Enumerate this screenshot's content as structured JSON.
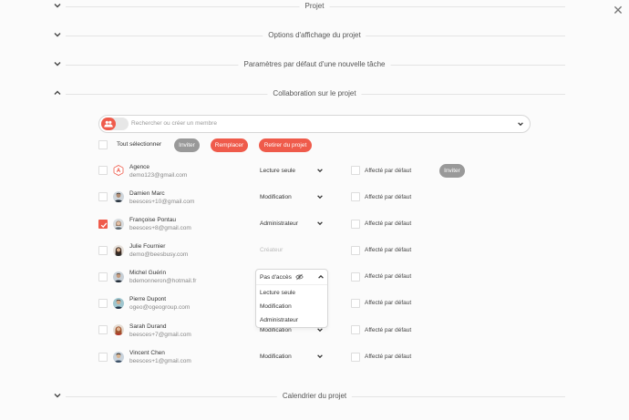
{
  "sections": {
    "projet": "Projet",
    "affichage": "Options d'affichage du projet",
    "parametres": "Paramètres par défaut d'une nouvelle tâche",
    "collaboration": "Collaboration sur le projet",
    "calendrier": "Calendrier du projet"
  },
  "search": {
    "placeholder": "Rechercher ou créer un membre"
  },
  "bulk": {
    "select_all": "Tout sélectionner",
    "invite": "Inviter",
    "replace": "Remplacer",
    "remove": "Retirer du projet"
  },
  "members": [
    {
      "name": "Agence",
      "email": "demo123@gmail.com",
      "role": "Lecture seule",
      "affect": "Affecté par défaut",
      "checked": false,
      "invite": "Inviter"
    },
    {
      "name": "Damien Marc",
      "email": "beesces+10@gmail.com",
      "role": "Modification",
      "affect": "Affecté par défaut",
      "checked": false
    },
    {
      "name": "Françoise Pontau",
      "email": "beesces+8@gmail.com",
      "role": "Administrateur",
      "affect": "Affecté par défaut",
      "checked": true
    },
    {
      "name": "Julie Fournier",
      "email": "demo@beesbusy.com",
      "role": "Créateur",
      "affect": "Affecté par défaut",
      "checked": false
    },
    {
      "name": "Michel Guérin",
      "email": "bdemonneron@hotmail.fr",
      "role": "Pas d'accès",
      "affect": "Affecté par défaut",
      "checked": false
    },
    {
      "name": "Pierre Dupont",
      "email": "ogeo@ogeogroup.com",
      "role": "",
      "affect": "Affecté par défaut",
      "checked": false
    },
    {
      "name": "Sarah Durand",
      "email": "beesces+7@gmail.com",
      "role": "Modification",
      "affect": "Affecté par défaut",
      "checked": false
    },
    {
      "name": "Vincent Chen",
      "email": "beesces+1@gmail.com",
      "role": "Modification",
      "affect": "Affecté par défaut",
      "checked": false
    }
  ],
  "role_dropdown": {
    "selected": "Pas d'accès",
    "options": [
      "Lecture seule",
      "Modification",
      "Administrateur"
    ]
  },
  "colors": {
    "accent": "#ef5b4b",
    "grey_button": "#999999"
  },
  "icons": {
    "close": "close-icon",
    "chevron": "chevron-down-icon",
    "team": "team-icon",
    "hidden": "eye-off-icon"
  }
}
